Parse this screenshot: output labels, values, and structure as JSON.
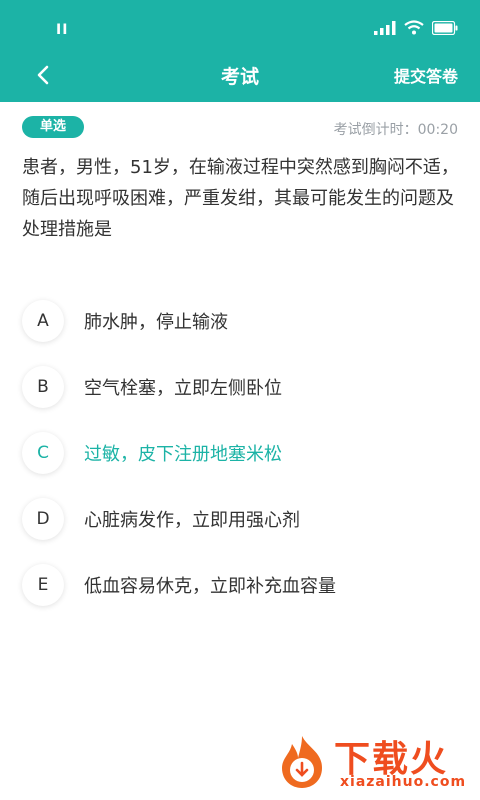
{
  "status_bar": {
    "left_text": "II"
  },
  "nav": {
    "title": "考试",
    "submit_label": "提交答卷"
  },
  "question": {
    "type": "单选",
    "timer_label": "考试倒计时：",
    "timer_value": "00:20",
    "text": "患者，男性，51岁，在输液过程中突然感到胸闷不适，随后出现呼吸困难，严重发绀，其最可能发生的问题及处理措施是"
  },
  "options": [
    {
      "letter": "A",
      "text": "肺水肿，停止输液",
      "selected": false
    },
    {
      "letter": "B",
      "text": "空气栓塞，立即左侧卧位",
      "selected": false
    },
    {
      "letter": "C",
      "text": "过敏，皮下注册地塞米松",
      "selected": true
    },
    {
      "letter": "D",
      "text": "心脏病发作，立即用强心剂",
      "selected": false
    },
    {
      "letter": "E",
      "text": "低血容易休克，立即补充血容量",
      "selected": false
    }
  ],
  "watermark": {
    "brand": "下载火",
    "url": "xiazaihuo.com"
  },
  "colors": {
    "primary": "#1cb3a6",
    "text": "#333333",
    "muted": "#9aa0a6",
    "watermark": "#ef4d1f"
  }
}
